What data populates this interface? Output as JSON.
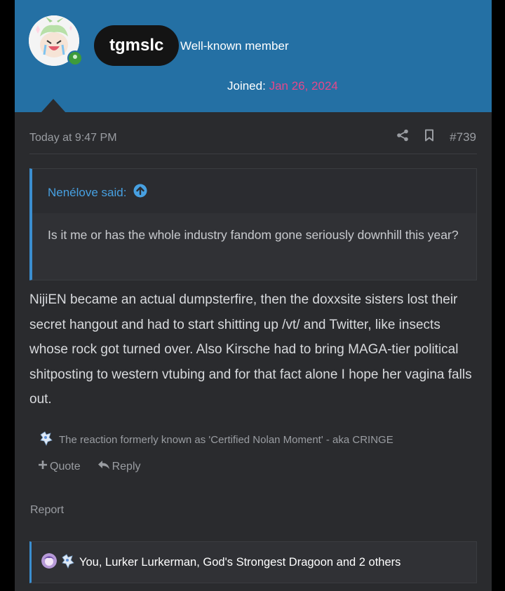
{
  "user": {
    "username": "tgmslc",
    "title": "Well-known member",
    "joined_label": "Joined:",
    "joined_date": "Jan 26, 2024"
  },
  "post": {
    "timestamp": "Today at 9:47 PM",
    "post_number": "#739",
    "quote": {
      "author": "Nenélove said:",
      "text": "Is it me or has the whole industry fandom gone seriously downhill this year?"
    },
    "message": "NijiEN became an actual dumpsterfire, then the doxxsite sisters lost their secret hangout and had to start shitting up /vt/ and Twitter, like insects whose rock got turned over. Also Kirsche had to bring MAGA-tier political shitposting to western vtubing and for that fact alone I hope her vagina falls out.",
    "reaction_text": "The reaction formerly known as 'Certified Nolan Moment' - aka CRINGE"
  },
  "actions": {
    "quote_label": "Quote",
    "reply_label": "Reply",
    "report_label": "Report"
  },
  "likes": {
    "text": "You, Lurker Lurkerman, God's Strongest Dragoon and 2 others"
  },
  "colors": {
    "header_bg": "#2470a4",
    "card_bg": "#2a2b2e",
    "accent_blue": "#47a0e1",
    "joined_date": "#e6478a"
  }
}
